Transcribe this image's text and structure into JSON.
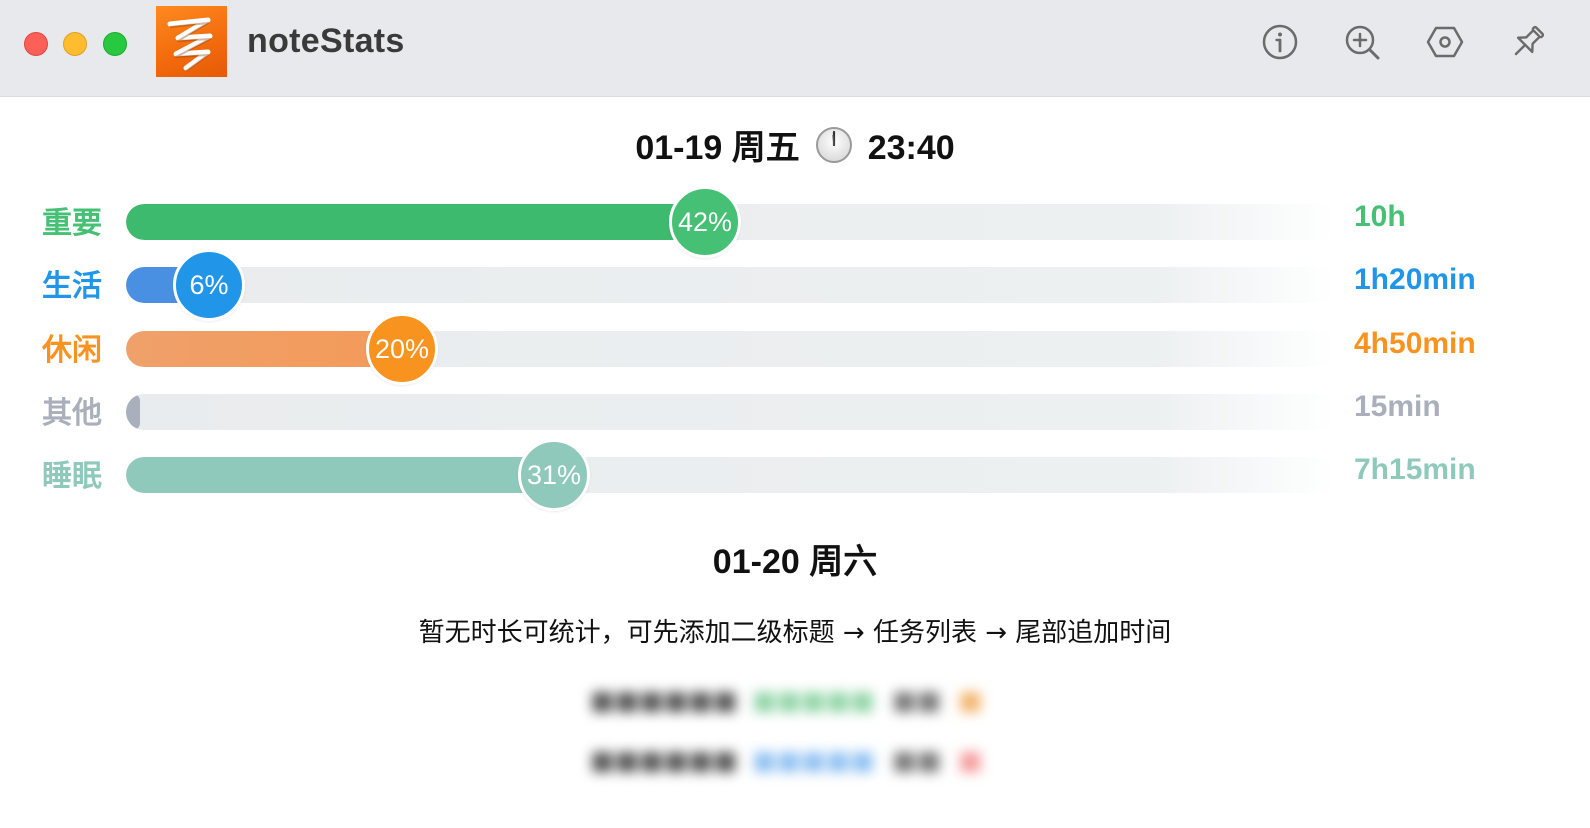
{
  "window": {
    "app_name": "noteStats",
    "toolbar": [
      "info-icon",
      "zoom-in-icon",
      "settings-icon",
      "pin-icon"
    ]
  },
  "days": [
    {
      "date_label": "01-19 周五",
      "time_label": "23:40",
      "categories": [
        {
          "name": "重要",
          "percent": 42,
          "percent_label": "42%",
          "duration": "10h",
          "color": "#45c075",
          "fill_color": "#3dba6e"
        },
        {
          "name": "生活",
          "percent": 6,
          "percent_label": "6%",
          "duration": "1h20min",
          "color": "#2196e8",
          "fill_color": "#4a90e2"
        },
        {
          "name": "休闲",
          "percent": 20,
          "percent_label": "20%",
          "duration": "4h50min",
          "color": "#f7931e",
          "fill_color": "#f39a5a"
        },
        {
          "name": "其他",
          "percent": 1,
          "percent_label": "",
          "duration": "15min",
          "color": "#a9b0bb",
          "fill_color": "#a9b0bb"
        },
        {
          "name": "睡眠",
          "percent": 31,
          "percent_label": "31%",
          "duration": "7h15min",
          "color": "#8fc9bb",
          "fill_color": "#8fc9bb"
        }
      ]
    },
    {
      "date_label": "01-20 周六",
      "empty_message": "暂无时长可统计，可先添加二级标题 → 任务列表 → 尾部追加时间"
    }
  ]
}
